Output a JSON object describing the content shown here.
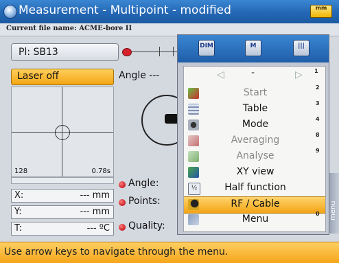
{
  "window": {
    "title": "Measurement - Multipoint - modified",
    "battery_label": "mm",
    "file_label": "Current file name: ACME-bore II"
  },
  "left": {
    "pl_label": "Pl: SB13",
    "laser_button": "Laser off",
    "angle_top": "Angle ---",
    "target_value_left": "128",
    "target_value_right": "0.78s",
    "readouts": [
      {
        "label": "X:",
        "value": "--- mm"
      },
      {
        "label": "Y:",
        "value": "--- mm"
      },
      {
        "label": "T:",
        "value": "--- ºC"
      }
    ],
    "stats": [
      "Angle:",
      "Points:",
      "Quality:"
    ]
  },
  "menu": {
    "head_buttons": [
      {
        "name": "dim-button",
        "label": "DIM"
      },
      {
        "name": "m-button",
        "label": "M"
      },
      {
        "name": "bars-button",
        "label": "|||"
      }
    ],
    "nav_center": "-",
    "nav_number": "1",
    "items": [
      {
        "label": "Start",
        "num": "2",
        "dim": true,
        "icon": "start-icon"
      },
      {
        "label": "Table",
        "num": "3",
        "dim": false,
        "icon": "table-icon"
      },
      {
        "label": "Mode",
        "num": "4",
        "dim": false,
        "icon": "mode-icon"
      },
      {
        "label": "Averaging",
        "num": "8",
        "dim": true,
        "icon": "averaging-icon"
      },
      {
        "label": "Analyse",
        "num": "9",
        "dim": true,
        "icon": "analyse-icon"
      },
      {
        "label": "XY view",
        "num": "",
        "dim": false,
        "icon": "xy-view-icon"
      },
      {
        "label": "Half function",
        "num": "",
        "dim": false,
        "icon": "half-function-icon"
      },
      {
        "label": "RF / Cable",
        "num": "",
        "dim": false,
        "icon": "rf-cable-icon",
        "selected": true
      },
      {
        "label": "Menu",
        "num": "0",
        "dim": false,
        "icon": "menu-icon"
      }
    ],
    "side_tab": "menu"
  },
  "status": "Use arrow keys to navigate through the menu."
}
